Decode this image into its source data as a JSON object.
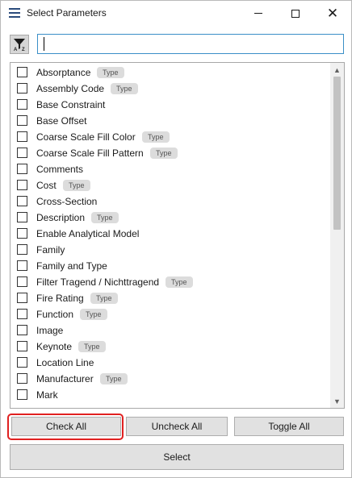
{
  "window": {
    "title": "Select Parameters",
    "icon": "list-icon",
    "controls": {
      "minimize": "minimize-icon",
      "maximize": "maximize-icon",
      "close": "close-icon"
    }
  },
  "filter": {
    "sort_icon": "sort-a-z-icon",
    "sort_text": "A↓Z",
    "search_value": "",
    "search_placeholder": ""
  },
  "parameters": [
    {
      "label": "Absorptance",
      "badge": "Type"
    },
    {
      "label": "Assembly Code",
      "badge": "Type"
    },
    {
      "label": "Base Constraint",
      "badge": ""
    },
    {
      "label": "Base Offset",
      "badge": ""
    },
    {
      "label": "Coarse Scale Fill Color",
      "badge": "Type"
    },
    {
      "label": "Coarse Scale Fill Pattern",
      "badge": "Type"
    },
    {
      "label": "Comments",
      "badge": ""
    },
    {
      "label": "Cost",
      "badge": "Type"
    },
    {
      "label": "Cross-Section",
      "badge": ""
    },
    {
      "label": "Description",
      "badge": "Type"
    },
    {
      "label": "Enable Analytical Model",
      "badge": ""
    },
    {
      "label": "Family",
      "badge": ""
    },
    {
      "label": "Family and Type",
      "badge": ""
    },
    {
      "label": "Filter Tragend / Nichttragend",
      "badge": "Type"
    },
    {
      "label": "Fire Rating",
      "badge": "Type"
    },
    {
      "label": "Function",
      "badge": "Type"
    },
    {
      "label": "Image",
      "badge": ""
    },
    {
      "label": "Keynote",
      "badge": "Type"
    },
    {
      "label": "Location Line",
      "badge": ""
    },
    {
      "label": "Manufacturer",
      "badge": "Type"
    },
    {
      "label": "Mark",
      "badge": ""
    }
  ],
  "buttons": {
    "check_all": "Check All",
    "uncheck_all": "Uncheck All",
    "toggle_all": "Toggle All",
    "select": "Select"
  },
  "colors": {
    "highlight": "#e02020",
    "input_focus": "#3a8fc7",
    "badge_bg": "#dcdcdc"
  }
}
